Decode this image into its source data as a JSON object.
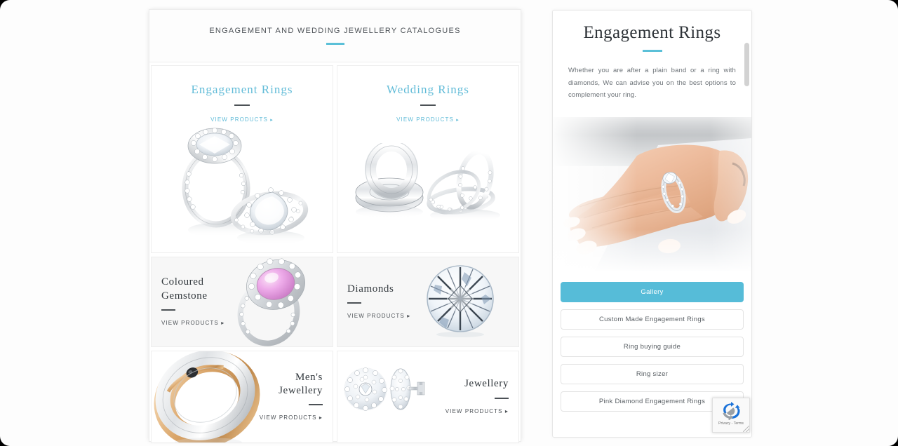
{
  "colors": {
    "accent": "#5bc0d8",
    "accent_button": "#56bcd8",
    "heading_dark": "#2e3338",
    "body_text": "#6d7378",
    "panel_bg": "#ffffff",
    "page_bg": "#fdfdfd",
    "cell_shaded": "#f7f7f7"
  },
  "catalogue": {
    "header_title": "ENGAGEMENT AND WEDDING JEWELLERY CATALOGUES",
    "view_products_label": "VIEW PRODUCTS",
    "arrow_glyph": "▸",
    "cells": [
      {
        "title": "Engagement Rings",
        "style": "centered-blue",
        "link": "VIEW PRODUCTS",
        "image": "engagement-rings-photo"
      },
      {
        "title": "Wedding Rings",
        "style": "centered-blue",
        "link": "VIEW PRODUCTS",
        "image": "wedding-rings-photo"
      },
      {
        "title_line1": "Coloured",
        "title_line2": "Gemstone",
        "style": "left-dark",
        "link": "VIEW PRODUCTS",
        "image": "pink-gemstone-ring-photo"
      },
      {
        "title_line1": "Diamonds",
        "title_line2": "",
        "style": "left-dark",
        "link": "VIEW PRODUCTS",
        "image": "round-brilliant-diamond-photo"
      },
      {
        "title_line1": "Men's",
        "title_line2": "Jewellery",
        "style": "right-dark",
        "link": "VIEW PRODUCTS",
        "image": "mens-two-tone-band-photo"
      },
      {
        "title_line1": "Jewellery",
        "title_line2": "",
        "style": "right-dark",
        "link": "VIEW PRODUCTS",
        "image": "diamond-stud-earrings-photo"
      }
    ]
  },
  "detail": {
    "title": "Engagement Rings",
    "body": "Whether you are after a plain band or a ring with diamonds, We can advise you on the best options to complement your ring.",
    "hero_image": "hand-wearing-engagement-ring-photo",
    "buttons": [
      {
        "label": "Gallery",
        "active": true
      },
      {
        "label": "Custom Made Engagement Rings",
        "active": false
      },
      {
        "label": "Ring buying guide",
        "active": false
      },
      {
        "label": "Ring sizer",
        "active": false
      },
      {
        "label": "Pink Diamond Engagement Rings",
        "active": false
      }
    ]
  },
  "recaptcha": {
    "terms_label": "Privacy - Terms",
    "icon": "recaptcha-icon"
  }
}
